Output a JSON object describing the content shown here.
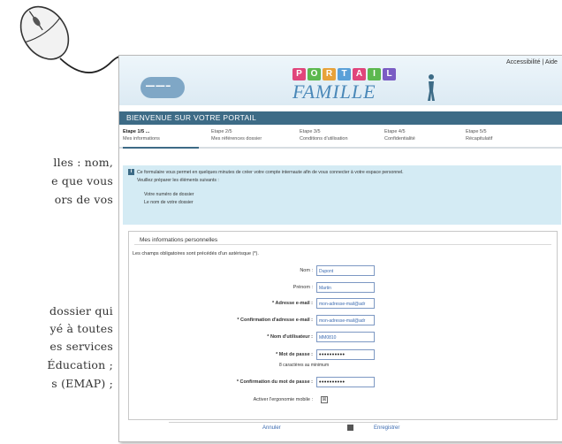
{
  "doc_lines": [
    {
      "text": "lles : nom,"
    },
    {
      "text": "e que vous"
    },
    {
      "text": "ors de vos"
    },
    {
      "text": "dossier qui"
    },
    {
      "text": "yé à toutes"
    },
    {
      "text": "es services"
    },
    {
      "text": "Éducation ;"
    },
    {
      "text": "s  (EMAP) ;"
    }
  ],
  "header": {
    "portail_letters": [
      "P",
      "O",
      "R",
      "T",
      "A",
      "I",
      "L"
    ],
    "famille": "FAMILLE",
    "accessibility": "Accessibilité |",
    "accessibility_more": "Aide"
  },
  "banner": "BIENVENUE SUR VOTRE PORTAIL",
  "steps": [
    {
      "num": "Etape 1/5 ...",
      "label": "Mes informations",
      "active": true
    },
    {
      "num": "Etape 2/5",
      "label": "Mes références dossier",
      "active": false
    },
    {
      "num": "Etape 3/5",
      "label": "Conditions d'utilisation",
      "active": false
    },
    {
      "num": "Etape 4/5",
      "label": "Confidentialité",
      "active": false
    },
    {
      "num": "Etape 5/5",
      "label": "Récapitulatif",
      "active": false
    }
  ],
  "info": {
    "intro": "Ce formulaire vous permet en quelques minutes de créer votre compte internaute afin de vous connecter à votre espace personnel.",
    "prepare": "Veuillez préparer les éléments suivants :",
    "items": [
      "Votre numéro de dossier",
      "Le nom de votre dossier"
    ]
  },
  "form": {
    "section_title": "Mes informations personnelles",
    "required_note": "Les champs obligatoires sont précédés d'un astérisque (*).",
    "fields": [
      {
        "label": "Nom :",
        "value": "Dupont",
        "required": false
      },
      {
        "label": "Prénom :",
        "value": "Martin",
        "required": false
      },
      {
        "label": "Adresse e-mail :",
        "value": "mon-adresse-mail@adr",
        "required": true
      },
      {
        "label": "Confirmation d'adresse e-mail :",
        "value": "mon-adresse-mail@adr",
        "required": true
      },
      {
        "label": "Nom d'utilisateur :",
        "value": "MM0810",
        "required": true
      },
      {
        "label": "Mot de passe :",
        "value": "••••••••••",
        "required": true
      },
      {
        "label": "Confirmation du mot de passe :",
        "value": "••••••••••",
        "required": true
      }
    ],
    "password_hint": "8 caractères au minimum",
    "mobile_label": "Activer l'ergonomie mobile :",
    "mobile_checked": "☒"
  },
  "buttons": {
    "cancel": "Annuler",
    "save": "Enregistrer"
  },
  "colors": {
    "banner": "#3d6b86",
    "info_bg": "#d4ebf4",
    "portail": [
      "#e0457b",
      "#5cb84f",
      "#e8a23a",
      "#5aa0d8",
      "#e0457b",
      "#5cb84f",
      "#7a5cc4"
    ]
  }
}
